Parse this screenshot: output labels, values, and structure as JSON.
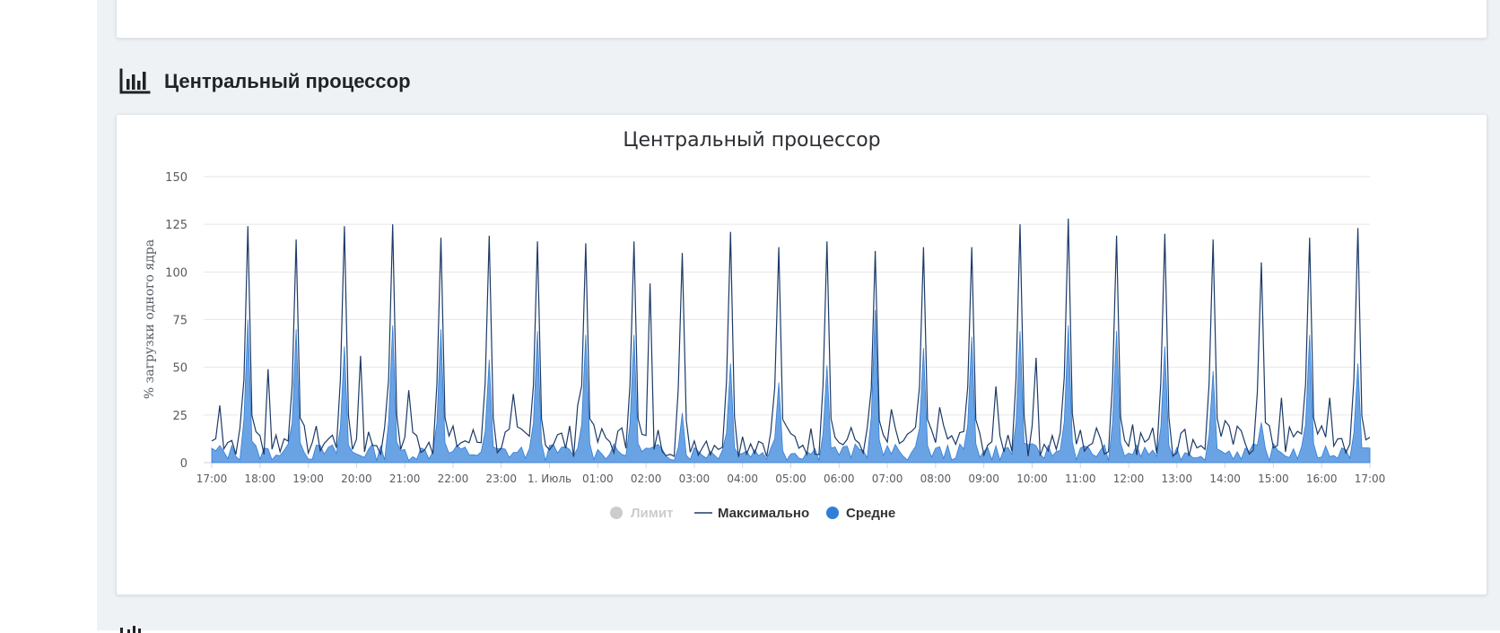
{
  "section": {
    "title": "Центральный процессор",
    "icon": "bar-chart-icon"
  },
  "colors": {
    "page_bg": "#eef2f5",
    "card_bg": "#ffffff",
    "max_line": "#1c3a67",
    "avg_fill": "#6aa3e4",
    "avg_dot": "#2f7ed8",
    "limit_disabled": "#cccccc",
    "grid": "#e6e6e6"
  },
  "chart_data": {
    "type": "area",
    "title": "Центральный процессор",
    "xlabel": "",
    "ylabel": "% загрузки одного ядра",
    "ylim": [
      0,
      150
    ],
    "yticks": [
      0,
      25,
      50,
      75,
      100,
      125,
      150
    ],
    "xlim": [
      "17:00",
      "17:00"
    ],
    "xticks": [
      "17:00",
      "18:00",
      "19:00",
      "20:00",
      "21:00",
      "22:00",
      "23:00",
      "1. Июль",
      "01:00",
      "02:00",
      "03:00",
      "04:00",
      "05:00",
      "06:00",
      "07:00",
      "08:00",
      "09:00",
      "10:00",
      "11:00",
      "12:00",
      "13:00",
      "14:00",
      "15:00",
      "16:00",
      "17:00"
    ],
    "grid": true,
    "legend_position": "bottom-center",
    "legend": [
      {
        "name": "Лимит",
        "marker": "circle",
        "hidden": true
      },
      {
        "name": "Максимально",
        "marker": "line"
      },
      {
        "name": "Средне",
        "marker": "circle"
      }
    ],
    "series": [
      {
        "name": "Максимально",
        "points_per_hour": 12,
        "peaks": [
          124,
          117,
          124,
          125,
          118,
          119,
          116,
          115,
          116,
          110,
          121,
          113,
          116,
          111,
          113,
          113,
          125,
          128,
          119,
          120,
          117,
          105,
          118,
          123
        ],
        "secondary_spikes": [
          {
            "x": "17:10",
            "y": 30
          },
          {
            "x": "18:10",
            "y": 49
          },
          {
            "x": "20:05",
            "y": 56
          },
          {
            "x": "21:05",
            "y": 38
          },
          {
            "x": "23:15",
            "y": 36
          },
          {
            "x": "00:35",
            "y": 30
          },
          {
            "x": "02:05",
            "y": 94
          },
          {
            "x": "07:05",
            "y": 28
          },
          {
            "x": "08:05",
            "y": 29
          },
          {
            "x": "09:15",
            "y": 40
          },
          {
            "x": "10:05",
            "y": 55
          },
          {
            "x": "12:05",
            "y": 20
          },
          {
            "x": "14:00",
            "y": 22
          },
          {
            "x": "15:10",
            "y": 34
          },
          {
            "x": "16:10",
            "y": 34
          }
        ],
        "baseline_range": [
          3,
          20
        ]
      },
      {
        "name": "Средне",
        "points_per_hour": 12,
        "peaks": [
          75,
          70,
          61,
          72,
          70,
          54,
          69,
          67,
          67,
          26,
          52,
          42,
          51,
          80,
          60,
          66,
          69,
          72,
          69,
          61,
          48,
          21,
          67,
          52
        ],
        "baseline_range": [
          1,
          10
        ]
      }
    ]
  }
}
